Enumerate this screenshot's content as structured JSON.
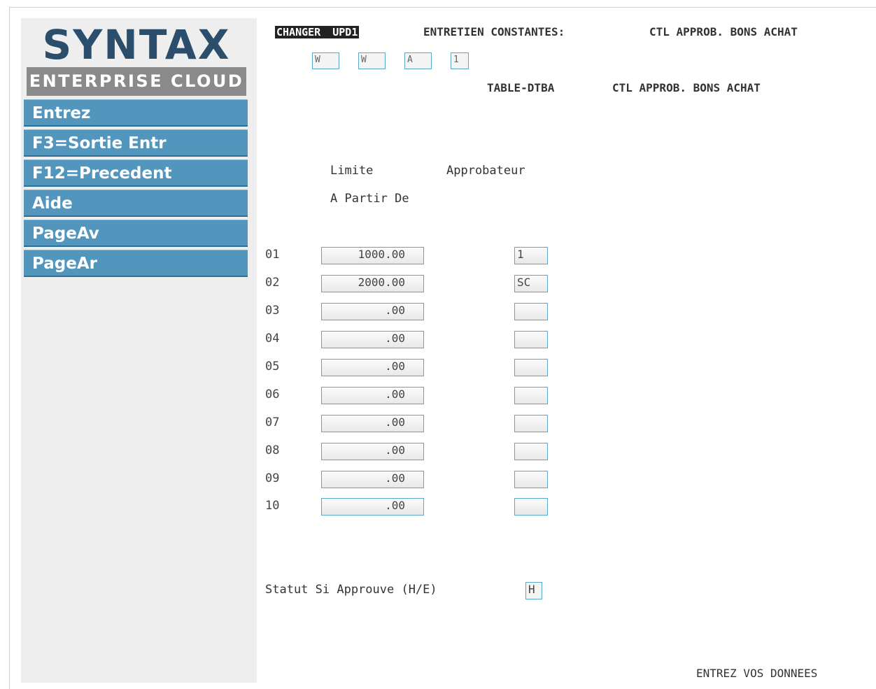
{
  "logo": {
    "title": "SYNTAX",
    "subtitle": "ENTERPRISE CLOUD"
  },
  "menu": [
    "Entrez",
    "F3=Sortie Entr",
    "F12=Precedent",
    "Aide",
    "PageAv",
    "PageAr"
  ],
  "header": {
    "mode": "CHANGER",
    "program": "UPD1",
    "title": "ENTRETIEN CONSTANTES:",
    "description": "CTL APPROB. BONS ACHAT",
    "keys": [
      "W",
      "W",
      "A",
      "1"
    ],
    "table_name": "TABLE-DTBA",
    "table_description": "CTL APPROB. BONS ACHAT"
  },
  "columns": {
    "limit": "Limite",
    "limit_sub": "A Partir De",
    "approver": "Approbateur"
  },
  "rows": [
    {
      "num": "01",
      "limit": "1000.00",
      "approver": "1"
    },
    {
      "num": "02",
      "limit": "2000.00",
      "approver": "SC"
    },
    {
      "num": "03",
      "limit": ".00",
      "approver": ""
    },
    {
      "num": "04",
      "limit": ".00",
      "approver": ""
    },
    {
      "num": "05",
      "limit": ".00",
      "approver": ""
    },
    {
      "num": "06",
      "limit": ".00",
      "approver": ""
    },
    {
      "num": "07",
      "limit": ".00",
      "approver": ""
    },
    {
      "num": "08",
      "limit": ".00",
      "approver": ""
    },
    {
      "num": "09",
      "limit": ".00",
      "approver": ""
    },
    {
      "num": "10",
      "limit": ".00",
      "approver": ""
    }
  ],
  "status": {
    "label": "Statut Si Approuve (H/E)",
    "value": "H"
  },
  "footer": {
    "message": "ENTREZ VOS DONNEES"
  }
}
